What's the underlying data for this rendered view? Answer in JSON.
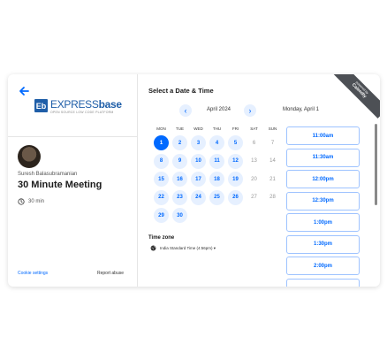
{
  "header": {
    "back_icon": "arrow-left-icon",
    "logo_mark": "Eb",
    "logo_word_a": "EXPRESS",
    "logo_word_b": "base",
    "logo_tagline": "OPEN SOURCE LOW CODE PLATFORM"
  },
  "event": {
    "host": "Suresh Balasubramanian",
    "title": "30 Minute Meeting",
    "duration": "30 min"
  },
  "footer": {
    "cookie_settings": "Cookie settings",
    "report_abuse": "Report abuse"
  },
  "calendar": {
    "heading": "Select a Date & Time",
    "month": "April 2024",
    "prev_icon": "chevron-left-icon",
    "next_icon": "chevron-right-icon",
    "weekdays": [
      "MON",
      "TUE",
      "WED",
      "THU",
      "FRI",
      "SAT",
      "SUN"
    ],
    "days": [
      {
        "n": "1",
        "state": "selected"
      },
      {
        "n": "2",
        "state": "avail"
      },
      {
        "n": "3",
        "state": "avail"
      },
      {
        "n": "4",
        "state": "avail"
      },
      {
        "n": "5",
        "state": "avail"
      },
      {
        "n": "6",
        "state": "unavail"
      },
      {
        "n": "7",
        "state": "unavail"
      },
      {
        "n": "8",
        "state": "avail"
      },
      {
        "n": "9",
        "state": "avail"
      },
      {
        "n": "10",
        "state": "avail"
      },
      {
        "n": "11",
        "state": "avail"
      },
      {
        "n": "12",
        "state": "avail"
      },
      {
        "n": "13",
        "state": "unavail"
      },
      {
        "n": "14",
        "state": "unavail"
      },
      {
        "n": "15",
        "state": "avail"
      },
      {
        "n": "16",
        "state": "avail"
      },
      {
        "n": "17",
        "state": "avail"
      },
      {
        "n": "18",
        "state": "avail"
      },
      {
        "n": "19",
        "state": "avail"
      },
      {
        "n": "20",
        "state": "unavail"
      },
      {
        "n": "21",
        "state": "unavail"
      },
      {
        "n": "22",
        "state": "avail"
      },
      {
        "n": "23",
        "state": "avail"
      },
      {
        "n": "24",
        "state": "avail"
      },
      {
        "n": "25",
        "state": "avail"
      },
      {
        "n": "26",
        "state": "avail"
      },
      {
        "n": "27",
        "state": "unavail"
      },
      {
        "n": "28",
        "state": "unavail"
      },
      {
        "n": "29",
        "state": "avail"
      },
      {
        "n": "30",
        "state": "avail"
      }
    ]
  },
  "timezone": {
    "label": "Time zone",
    "value": "India Standard Time (4:56pm) ▾"
  },
  "times": {
    "selected_date": "Monday, April 1",
    "slots": [
      "11:00am",
      "11:30am",
      "12:00pm",
      "12:30pm",
      "1:00pm",
      "1:30pm",
      "2:00pm",
      ""
    ]
  },
  "ribbon": {
    "line1": "powered by",
    "line2": "Calendly"
  },
  "colors": {
    "accent": "#0069ff",
    "accent_light": "#e6f0ff",
    "logo_blue": "#1f5ea8"
  }
}
